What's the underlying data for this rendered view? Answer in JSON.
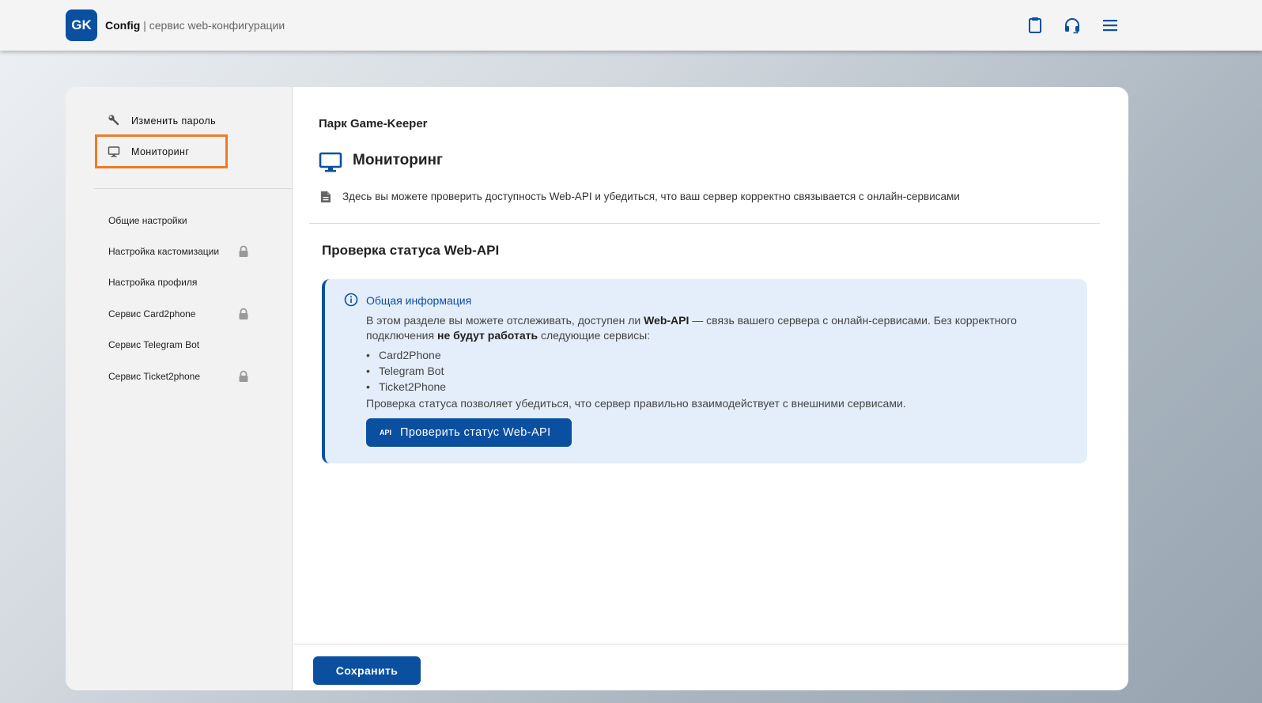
{
  "header": {
    "logo_text": "GK",
    "brand_name": "Config",
    "brand_separator": " | ",
    "brand_subtitle": "сервис web-конфигурации",
    "icons": [
      "clipboard-icon",
      "headset-icon",
      "menu-icon"
    ]
  },
  "sidebar": {
    "top_items": [
      {
        "label": "Изменить пароль",
        "icon": "wrench-icon"
      },
      {
        "label": "Мониторинг",
        "icon": "monitor-icon",
        "active": true
      }
    ],
    "items": [
      {
        "label": "Общие настройки",
        "locked": false
      },
      {
        "label": "Настройка кастомизации",
        "locked": true
      },
      {
        "label": "Настройка профиля",
        "locked": false
      },
      {
        "label": "Сервис Card2phone",
        "locked": true
      },
      {
        "label": "Сервис Telegram Bot",
        "locked": false
      },
      {
        "label": "Сервис Ticket2phone",
        "locked": true
      }
    ]
  },
  "main": {
    "park_name": "Парк Game-Keeper",
    "page_title": "Мониторинг",
    "description": "Здесь вы можете проверить доступность Web-API и убедиться, что ваш сервер корректно связывается с онлайн-сервисами",
    "section_title": "Проверка статуса Web-API",
    "info": {
      "title": "Общая информация",
      "text_1": "В этом разделе вы можете отслеживать, доступен ли ",
      "text_bold_1": "Web-API",
      "text_2": " — связь вашего сервера с онлайн-сервисами. Без корректного подключения ",
      "text_bold_2": "не будут работать",
      "text_3": " следующие сервисы:",
      "services": [
        "Card2Phone",
        "Telegram Bot",
        "Ticket2Phone"
      ],
      "note": "Проверка статуса позволяет убедиться, что сервер правильно взаимодействует с внешними сервисами.",
      "button_badge": "API",
      "button_label": "Проверить статус Web-API"
    },
    "save_label": "Сохранить"
  },
  "colors": {
    "accent": "#0b4fa0",
    "highlight": "#f07a25",
    "info_bg": "#e4eefa"
  }
}
